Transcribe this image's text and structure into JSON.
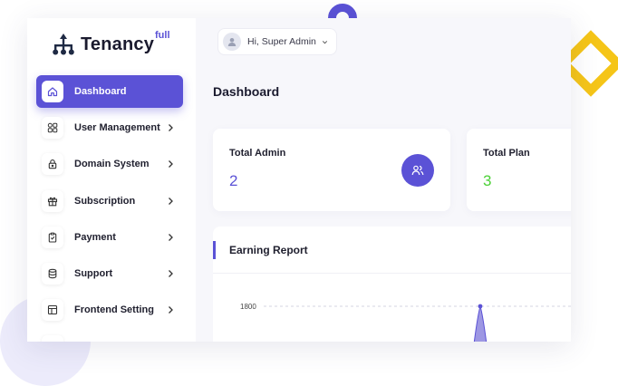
{
  "app": {
    "name": "Tenancy",
    "name_sup": "full"
  },
  "header": {
    "user_greeting": "Hi, Super Admin"
  },
  "sidebar": {
    "items": [
      {
        "label": "Dashboard",
        "icon": "home-icon",
        "active": true
      },
      {
        "label": "User Management",
        "icon": "grid-icon",
        "has_children": true
      },
      {
        "label": "Domain System",
        "icon": "lock-icon",
        "has_children": true
      },
      {
        "label": "Subscription",
        "icon": "gift-icon",
        "has_children": true
      },
      {
        "label": "Payment",
        "icon": "clipboard-icon",
        "has_children": true
      },
      {
        "label": "Support",
        "icon": "database-icon",
        "has_children": true
      },
      {
        "label": "Frontend Setting",
        "icon": "layout-icon",
        "has_children": true
      }
    ]
  },
  "page": {
    "title": "Dashboard"
  },
  "stats": [
    {
      "label": "Total Admin",
      "value": "2",
      "value_color": "#5b52d6",
      "icon": "users-icon"
    },
    {
      "label": "Total Plan",
      "value": "3",
      "value_color": "#4cd137"
    }
  ],
  "report": {
    "title": "Earning Report",
    "y_tick": "1800"
  },
  "colors": {
    "accent": "#5b52d6",
    "plan_green": "#4cd137",
    "deco_yellow": "#f5c518"
  }
}
